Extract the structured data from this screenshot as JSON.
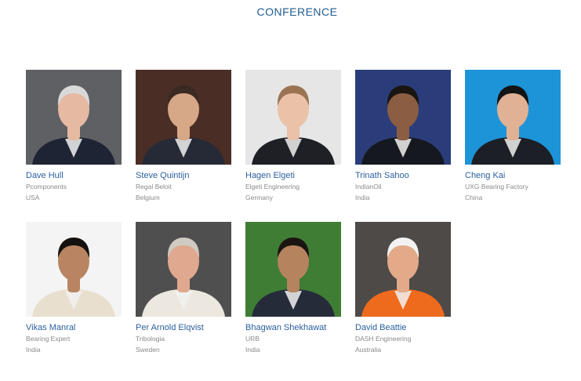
{
  "section_title": "CONFERENCE",
  "speakers": [
    {
      "name": "Dave Hull",
      "company": "Pcomponents",
      "country": "USA",
      "bg": "#5e6064",
      "suit": "#1e2433",
      "skin": "#e6b9a3",
      "hair": "#d9d9d9"
    },
    {
      "name": "Steve Quintijn",
      "company": "Regal Beloit",
      "country": "Belgium",
      "bg": "#4a2e26",
      "suit": "#262a36",
      "skin": "#d7a887",
      "hair": "#3b2a22"
    },
    {
      "name": "Hagen Elgeti",
      "company": "Elgeti Engineering",
      "country": "Germany",
      "bg": "#e6e6e6",
      "suit": "#1e2026",
      "skin": "#e9c2a8",
      "hair": "#9a7452"
    },
    {
      "name": "Trinath Sahoo",
      "company": "IndianOil",
      "country": "India",
      "bg": "#2a3d7a",
      "suit": "#16181f",
      "skin": "#8b5d43",
      "hair": "#1b1512"
    },
    {
      "name": "Cheng Kai",
      "company": "UXG Bearing Factory",
      "country": "China",
      "bg": "#1e94d8",
      "suit": "#1c1f26",
      "skin": "#e0b293",
      "hair": "#141414"
    },
    {
      "name": "Vikas Manral",
      "company": "Bearing Expert",
      "country": "India",
      "bg": "#f4f4f4",
      "suit": "#e8dfcf",
      "skin": "#b88461",
      "hair": "#15110e"
    },
    {
      "name": "Per Arnold Elqvist",
      "company": "Tribologia",
      "country": "Sweden",
      "bg": "#4f4f4f",
      "suit": "#ece8e0",
      "skin": "#e0a88e",
      "hair": "#cfcac2"
    },
    {
      "name": "Bhagwan Shekhawat",
      "company": "URB",
      "country": "India",
      "bg": "#3f7d34",
      "suit": "#262b3a",
      "skin": "#b6835f",
      "hair": "#1a1512"
    },
    {
      "name": "David Beattie",
      "company": "DASH Engineering",
      "country": "Australia",
      "bg": "#4d4a48",
      "suit": "#ee6a1c",
      "skin": "#e2aa89",
      "hair": "#f2f2f2"
    }
  ]
}
